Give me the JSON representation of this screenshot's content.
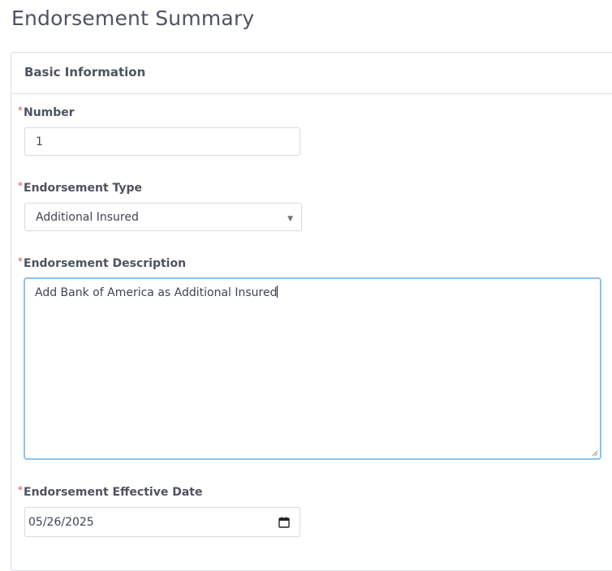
{
  "page": {
    "title": "Endorsement Summary"
  },
  "panel": {
    "title": "Basic Information"
  },
  "fields": {
    "required_marker": "*",
    "number": {
      "label": "Number",
      "value": "1"
    },
    "endorsement_type": {
      "label": "Endorsement Type",
      "value": "Additional Insured",
      "caret": "▼"
    },
    "endorsement_description": {
      "label": "Endorsement Description",
      "value": "Add Bank of America as Additional Insured"
    },
    "effective_date": {
      "label": "Endorsement Effective Date",
      "value": "05/26/2025"
    }
  },
  "colors": {
    "required": "#d9534f",
    "focus_border": "#88c5ee",
    "input_border": "#d7dae0",
    "text": "#3e4451"
  }
}
